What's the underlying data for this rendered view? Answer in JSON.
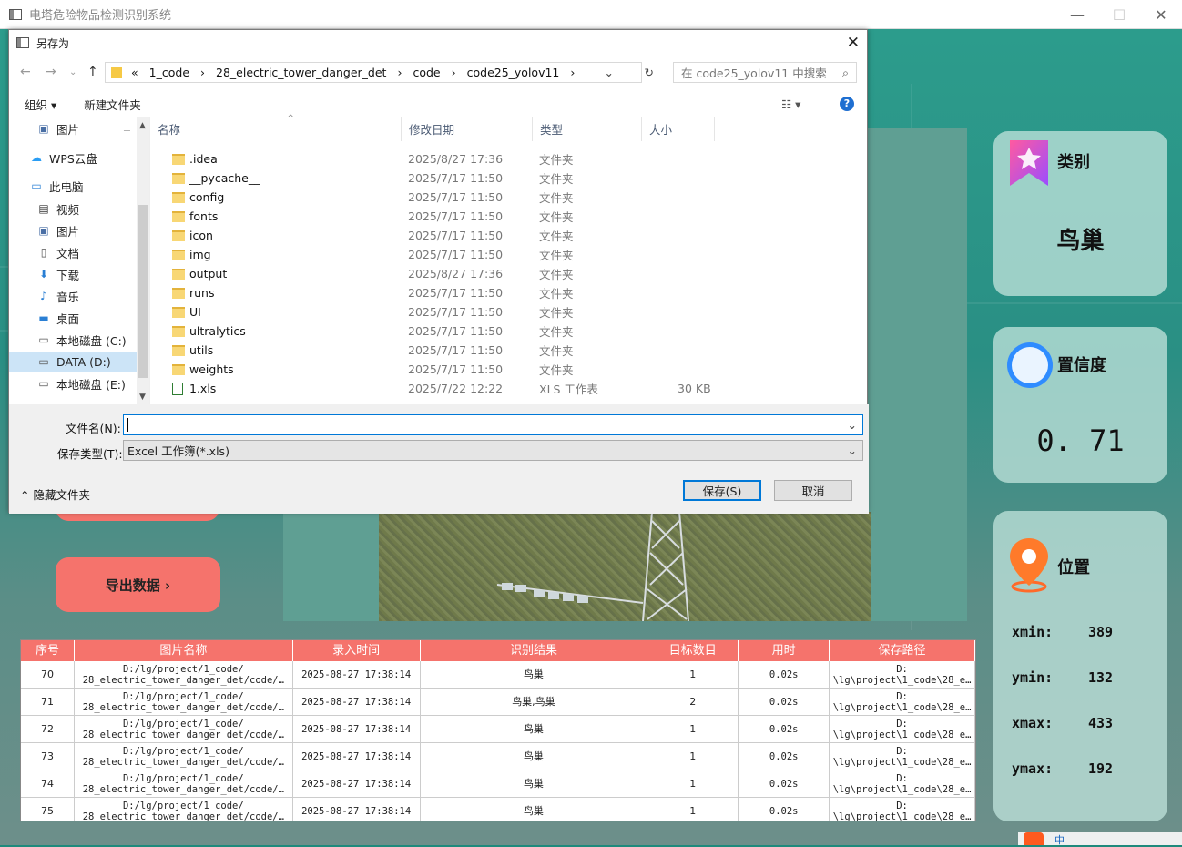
{
  "window": {
    "title": "电塔危险物品检测识别系统"
  },
  "dialog": {
    "title": "另存为",
    "breadcrumb": [
      "«",
      "1_code",
      "›",
      "28_electric_tower_danger_det",
      "›",
      "code",
      "›",
      "code25_yolov11",
      "›"
    ],
    "search_placeholder": "在 code25_yolov11 中搜索",
    "toolbar": {
      "organize": "组织 ▾",
      "new_folder": "新建文件夹"
    },
    "nav": [
      {
        "label": "图片",
        "icon": "picture-icon"
      },
      {
        "label": "WPS云盘",
        "icon": "cloud-icon"
      },
      {
        "label": "此电脑",
        "icon": "computer-icon"
      },
      {
        "label": "视频",
        "icon": "video-icon"
      },
      {
        "label": "图片",
        "icon": "picture-icon"
      },
      {
        "label": "文档",
        "icon": "document-icon"
      },
      {
        "label": "下载",
        "icon": "download-icon"
      },
      {
        "label": "音乐",
        "icon": "music-icon"
      },
      {
        "label": "桌面",
        "icon": "desktop-icon"
      },
      {
        "label": "本地磁盘 (C:)",
        "icon": "drive-icon"
      },
      {
        "label": "DATA (D:)",
        "icon": "drive-icon"
      },
      {
        "label": "本地磁盘 (E:)",
        "icon": "drive-icon"
      }
    ],
    "columns": {
      "name": "名称",
      "date": "修改日期",
      "type": "类型",
      "size": "大小"
    },
    "files": [
      {
        "name": ".idea",
        "date": "2025/8/27 17:36",
        "type": "文件夹",
        "size": "",
        "kind": "folder"
      },
      {
        "name": "__pycache__",
        "date": "2025/7/17 11:50",
        "type": "文件夹",
        "size": "",
        "kind": "folder"
      },
      {
        "name": "config",
        "date": "2025/7/17 11:50",
        "type": "文件夹",
        "size": "",
        "kind": "folder"
      },
      {
        "name": "fonts",
        "date": "2025/7/17 11:50",
        "type": "文件夹",
        "size": "",
        "kind": "folder"
      },
      {
        "name": "icon",
        "date": "2025/7/17 11:50",
        "type": "文件夹",
        "size": "",
        "kind": "folder"
      },
      {
        "name": "img",
        "date": "2025/7/17 11:50",
        "type": "文件夹",
        "size": "",
        "kind": "folder"
      },
      {
        "name": "output",
        "date": "2025/8/27 17:36",
        "type": "文件夹",
        "size": "",
        "kind": "folder"
      },
      {
        "name": "runs",
        "date": "2025/7/17 11:50",
        "type": "文件夹",
        "size": "",
        "kind": "folder"
      },
      {
        "name": "UI",
        "date": "2025/7/17 11:50",
        "type": "文件夹",
        "size": "",
        "kind": "folder"
      },
      {
        "name": "ultralytics",
        "date": "2025/7/17 11:50",
        "type": "文件夹",
        "size": "",
        "kind": "folder"
      },
      {
        "name": "utils",
        "date": "2025/7/17 11:50",
        "type": "文件夹",
        "size": "",
        "kind": "folder"
      },
      {
        "name": "weights",
        "date": "2025/7/17 11:50",
        "type": "文件夹",
        "size": "",
        "kind": "folder"
      },
      {
        "name": "1.xls",
        "date": "2025/7/22 12:22",
        "type": "XLS 工作表",
        "size": "30 KB",
        "kind": "xls"
      }
    ],
    "filename_label": "文件名(N):",
    "filename_value": "",
    "filetype_label": "保存类型(T):",
    "filetype_value": "Excel 工作簿(*.xls)",
    "hide_folders": "隐藏文件夹",
    "save": "保存(S)",
    "cancel": "取消"
  },
  "export_button": "导出数据 ›",
  "cards": {
    "category": {
      "label": "类别",
      "value": "鸟巢"
    },
    "confidence": {
      "label": "置信度",
      "value": "0. 71"
    },
    "position": {
      "label": "位置",
      "xmin_k": "xmin:",
      "xmin": "389",
      "ymin_k": "ymin:",
      "ymin": "132",
      "xmax_k": "xmax:",
      "xmax": "433",
      "ymax_k": "ymax:",
      "ymax": "192"
    }
  },
  "table": {
    "headers": [
      "序号",
      "图片名称",
      "录入时间",
      "识别结果",
      "目标数目",
      "用时",
      "保存路径"
    ],
    "rows": [
      {
        "id": "70",
        "name1": "D:/lg/project/1_code/",
        "name2": "28_electric_tower_danger_det/code/…",
        "time": "2025-08-27 17:38:14",
        "result": "鸟巢",
        "count": "1",
        "dur": "0.02s",
        "path1": "D:",
        "path2": "\\lg\\project\\1_code\\28_e…"
      },
      {
        "id": "71",
        "name1": "D:/lg/project/1_code/",
        "name2": "28_electric_tower_danger_det/code/…",
        "time": "2025-08-27 17:38:14",
        "result": "鸟巢,鸟巢",
        "count": "2",
        "dur": "0.02s",
        "path1": "D:",
        "path2": "\\lg\\project\\1_code\\28_e…"
      },
      {
        "id": "72",
        "name1": "D:/lg/project/1_code/",
        "name2": "28_electric_tower_danger_det/code/…",
        "time": "2025-08-27 17:38:14",
        "result": "鸟巢",
        "count": "1",
        "dur": "0.02s",
        "path1": "D:",
        "path2": "\\lg\\project\\1_code\\28_e…"
      },
      {
        "id": "73",
        "name1": "D:/lg/project/1_code/",
        "name2": "28_electric_tower_danger_det/code/…",
        "time": "2025-08-27 17:38:14",
        "result": "鸟巢",
        "count": "1",
        "dur": "0.02s",
        "path1": "D:",
        "path2": "\\lg\\project\\1_code\\28_e…"
      },
      {
        "id": "74",
        "name1": "D:/lg/project/1_code/",
        "name2": "28_electric_tower_danger_det/code/…",
        "time": "2025-08-27 17:38:14",
        "result": "鸟巢",
        "count": "1",
        "dur": "0.02s",
        "path1": "D:",
        "path2": "\\lg\\project\\1_code\\28_e…"
      },
      {
        "id": "75",
        "name1": "D:/lg/project/1_code/",
        "name2": "28_electric_tower_danger_det/code/…",
        "time": "2025-08-27 17:38:14",
        "result": "鸟巢",
        "count": "1",
        "dur": "0.02s",
        "path1": "D:",
        "path2": "\\lg\\project\\1_code\\28_e…"
      }
    ]
  },
  "taskbar": {
    "ime": "中"
  },
  "colors": {
    "accent_red": "#f5736c",
    "teal": "#2a8f84",
    "card": "#bee1da",
    "dialog_blue": "#0078d7"
  }
}
